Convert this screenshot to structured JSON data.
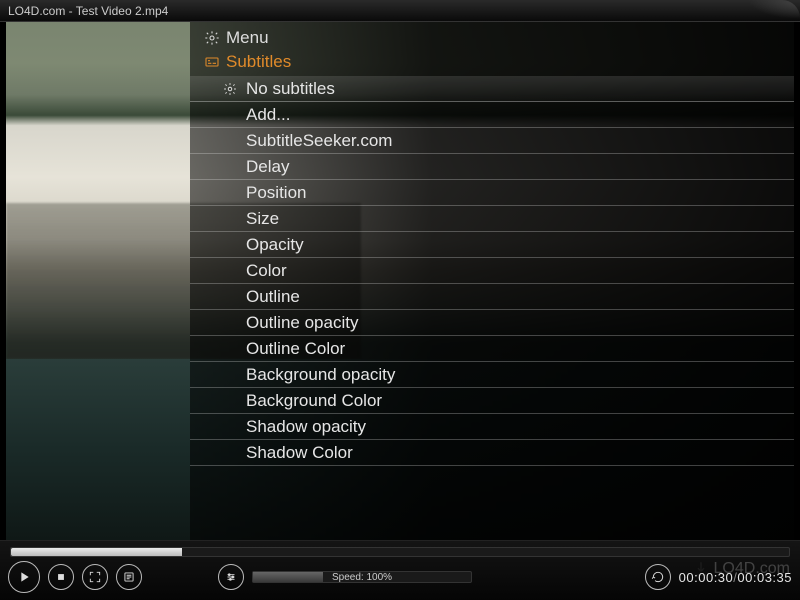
{
  "title": "LO4D.com - Test Video 2.mp4",
  "menu": {
    "header": "Menu",
    "section": "Subtitles",
    "items": [
      {
        "label": "No subtitles",
        "selected": true,
        "leading_icon": "gear-icon"
      },
      {
        "label": "Add...",
        "selected": false
      },
      {
        "label": "SubtitleSeeker.com",
        "selected": false
      },
      {
        "label": "Delay",
        "selected": false
      },
      {
        "label": "Position",
        "selected": false
      },
      {
        "label": "Size",
        "selected": false
      },
      {
        "label": "Opacity",
        "selected": false
      },
      {
        "label": "Color",
        "selected": false
      },
      {
        "label": "Outline",
        "selected": false
      },
      {
        "label": "Outline opacity",
        "selected": false
      },
      {
        "label": "Outline Color",
        "selected": false
      },
      {
        "label": "Background opacity",
        "selected": false
      },
      {
        "label": "Background Color",
        "selected": false
      },
      {
        "label": "Shadow opacity",
        "selected": false
      },
      {
        "label": "Shadow Color",
        "selected": false
      }
    ]
  },
  "playback": {
    "speed_label": "Speed: 100%",
    "current_time": "00:00:30",
    "total_time": "00:03:35",
    "progress_percent": 22
  },
  "watermark": "LO4D.com"
}
